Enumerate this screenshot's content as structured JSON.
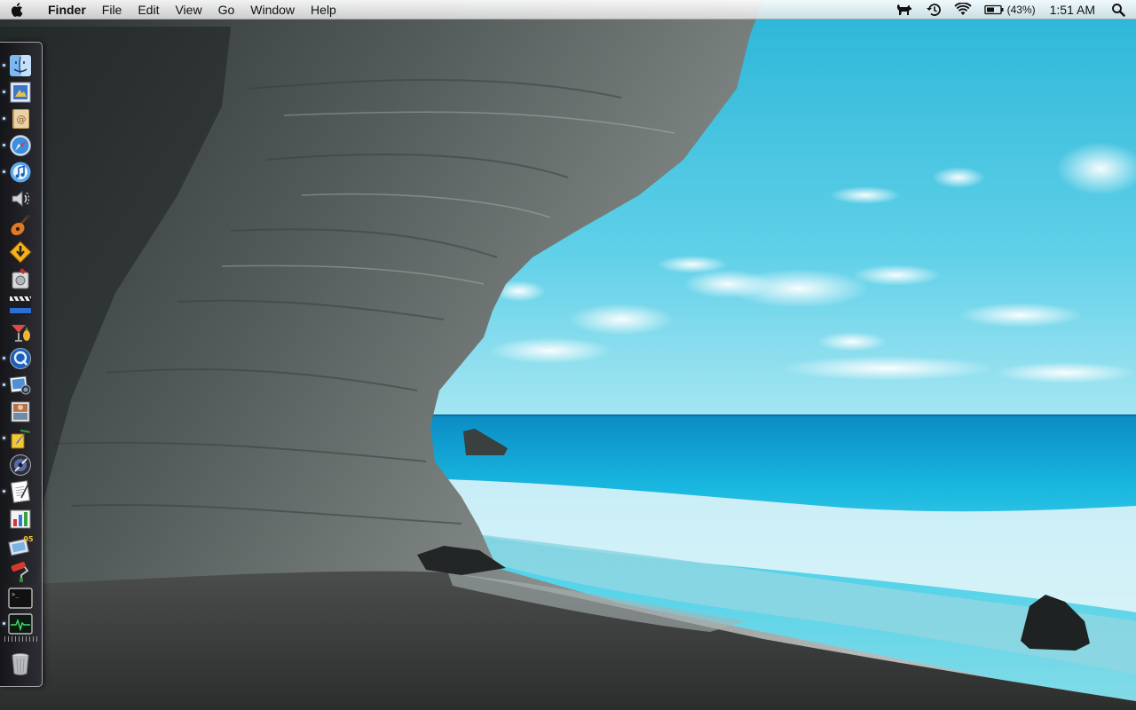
{
  "menubar": {
    "apple_menu": "apple-icon",
    "app_name": "Finder",
    "menus": [
      "File",
      "Edit",
      "View",
      "Go",
      "Window",
      "Help"
    ],
    "status_icons": [
      "dog-icon",
      "time-machine-icon",
      "wifi-icon",
      "battery-icon"
    ],
    "battery_percent": "(43%)",
    "clock": "1:51 AM",
    "spotlight": "spotlight-search-icon"
  },
  "wallpaper": {
    "subject": "sea cave overlooking a turquoise beach",
    "colors": {
      "sky": "#3fc3de",
      "sea": "#17a9d6",
      "rock": "#6b7270"
    }
  },
  "dock": {
    "position": "left",
    "items": [
      {
        "name": "finder-icon",
        "running": true
      },
      {
        "name": "preview-icon",
        "running": true
      },
      {
        "name": "address-book-icon",
        "running": true
      },
      {
        "name": "safari-icon",
        "running": true
      },
      {
        "name": "itunes-icon",
        "running": true
      },
      {
        "name": "audio-speaker-icon",
        "running": false
      },
      {
        "name": "garageband-icon",
        "running": false
      },
      {
        "name": "warning-sign-icon",
        "running": false
      },
      {
        "name": "disk-utility-icon",
        "running": false
      },
      {
        "name": "clapper-board-icon",
        "running": false
      },
      {
        "name": "cocktail-icon",
        "running": false
      },
      {
        "name": "quicktime-icon",
        "running": true
      },
      {
        "name": "iphoto-icon",
        "running": true
      },
      {
        "name": "photo-booth-icon",
        "running": false
      },
      {
        "name": "pencil-paint-icon",
        "running": true
      },
      {
        "name": "aperture-icon",
        "running": false
      },
      {
        "name": "textedit-icon",
        "running": true
      },
      {
        "name": "chart-app-icon",
        "running": false
      },
      {
        "name": "iwork-icon",
        "running": false
      },
      {
        "name": "paint-roller-icon",
        "running": false
      },
      {
        "name": "terminal-icon",
        "running": false
      },
      {
        "name": "activity-monitor-icon",
        "running": true
      },
      {
        "name": "trash-icon",
        "running": false
      }
    ]
  }
}
